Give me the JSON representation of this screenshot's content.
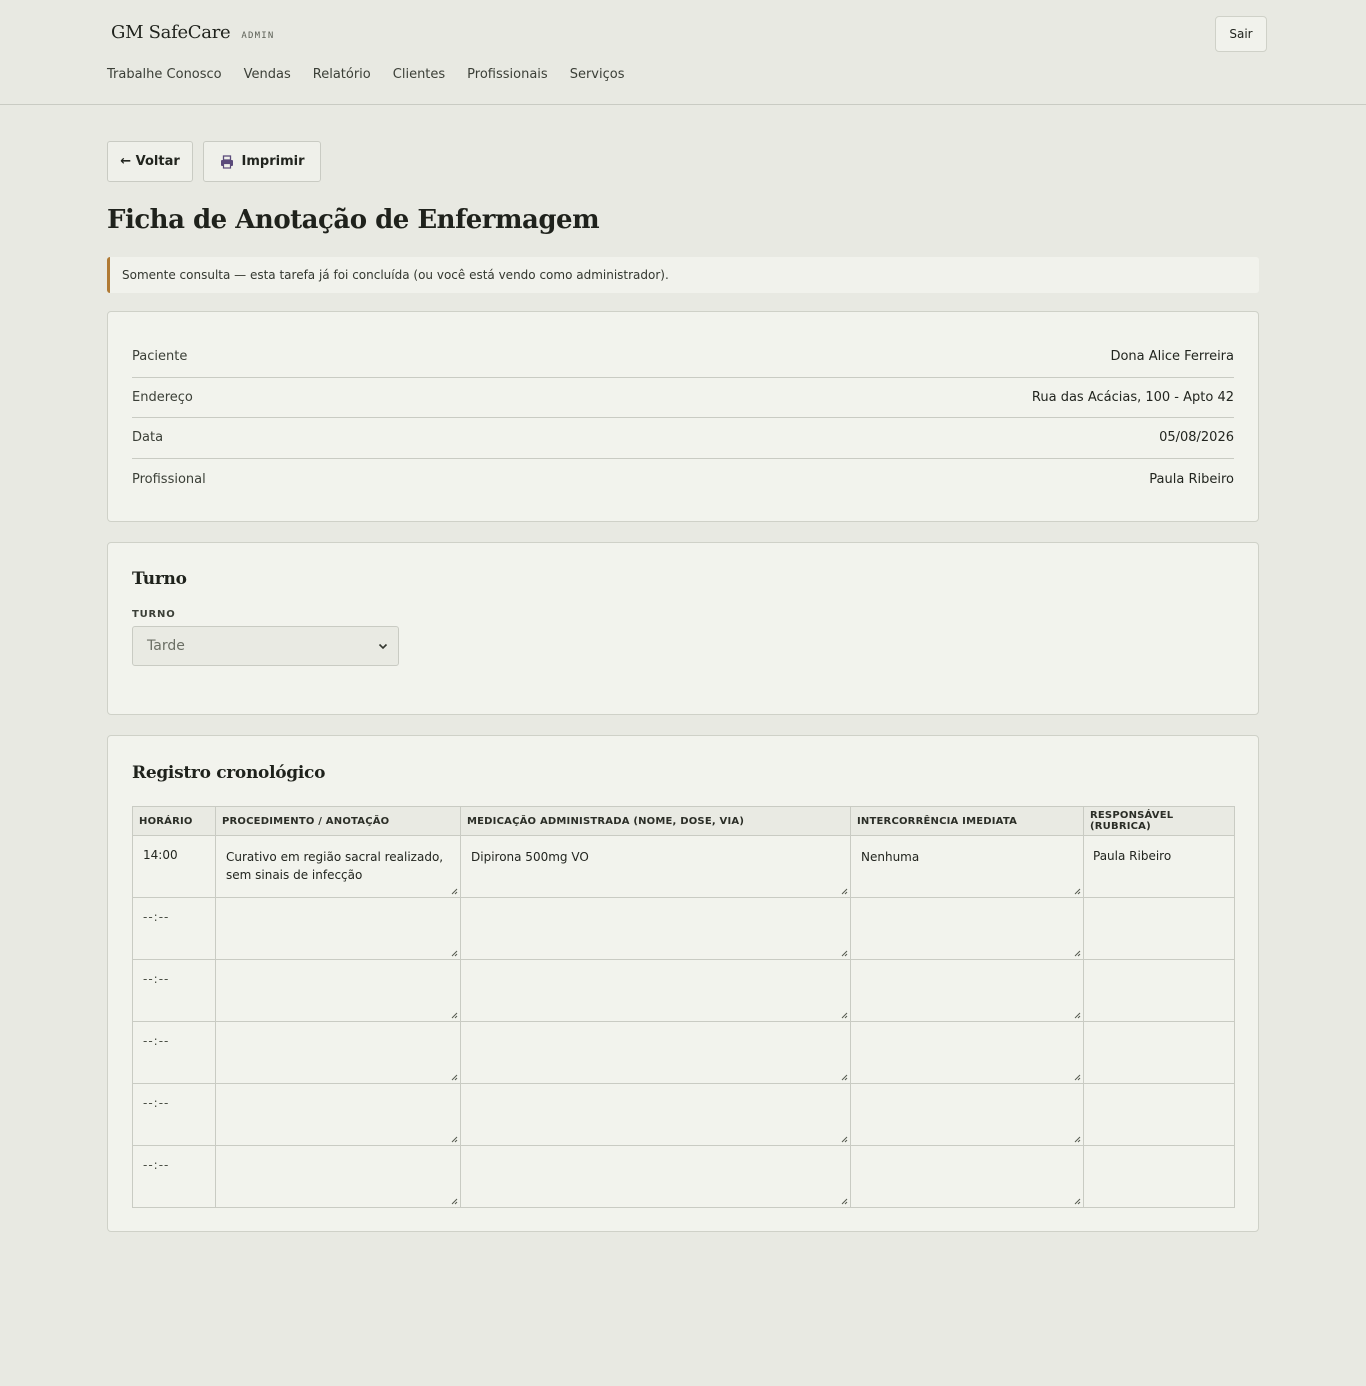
{
  "header": {
    "brand": "GM SafeCare",
    "brand_tag": "ADMIN",
    "logout_label": "Sair",
    "nav": [
      "Trabalhe Conosco",
      "Vendas",
      "Relatório",
      "Clientes",
      "Profissionais",
      "Serviços"
    ]
  },
  "actions": {
    "back_label": "← Voltar",
    "print_label": "Imprimir"
  },
  "page": {
    "title": "Ficha de Anotação de Enfermagem",
    "notice": "Somente consulta — esta tarefa já foi concluída (ou você está vendo como administrador)."
  },
  "info": [
    {
      "label": "Paciente",
      "value": "Dona Alice Ferreira"
    },
    {
      "label": "Endereço",
      "value": "Rua das Acácias, 100 - Apto 42"
    },
    {
      "label": "Data",
      "value": "05/08/2026"
    },
    {
      "label": "Profissional",
      "value": "Paula Ribeiro"
    }
  ],
  "shift": {
    "title": "Turno",
    "field_label": "TURNO",
    "selected": "Tarde"
  },
  "log": {
    "title": "Registro cronológico",
    "columns": [
      "HORÁRIO",
      "PROCEDIMENTO / ANOTAÇÃO",
      "MEDICAÇÃO ADMINISTRADA (NOME, DOSE, VIA)",
      "INTERCORRÊNCIA IMEDIATA",
      "RESPONSÁVEL (RUBRICA)"
    ],
    "rows": [
      {
        "time": "14:00",
        "procedure": "Curativo em região sacral realizado, sem sinais de infecção",
        "medication": "Dipirona 500mg VO",
        "incident": "Nenhuma",
        "responsible": "Paula Ribeiro"
      },
      {
        "time": "--:--",
        "procedure": "",
        "medication": "",
        "incident": "",
        "responsible": ""
      },
      {
        "time": "--:--",
        "procedure": "",
        "medication": "",
        "incident": "",
        "responsible": ""
      },
      {
        "time": "--:--",
        "procedure": "",
        "medication": "",
        "incident": "",
        "responsible": ""
      },
      {
        "time": "--:--",
        "procedure": "",
        "medication": "",
        "incident": "",
        "responsible": ""
      },
      {
        "time": "--:--",
        "procedure": "",
        "medication": "",
        "incident": "",
        "responsible": ""
      }
    ]
  },
  "colors": {
    "background": "#e8e9e2",
    "card": "#f2f3ed",
    "notice_accent": "#b07a34",
    "printer_icon": "#5a4a7a"
  }
}
